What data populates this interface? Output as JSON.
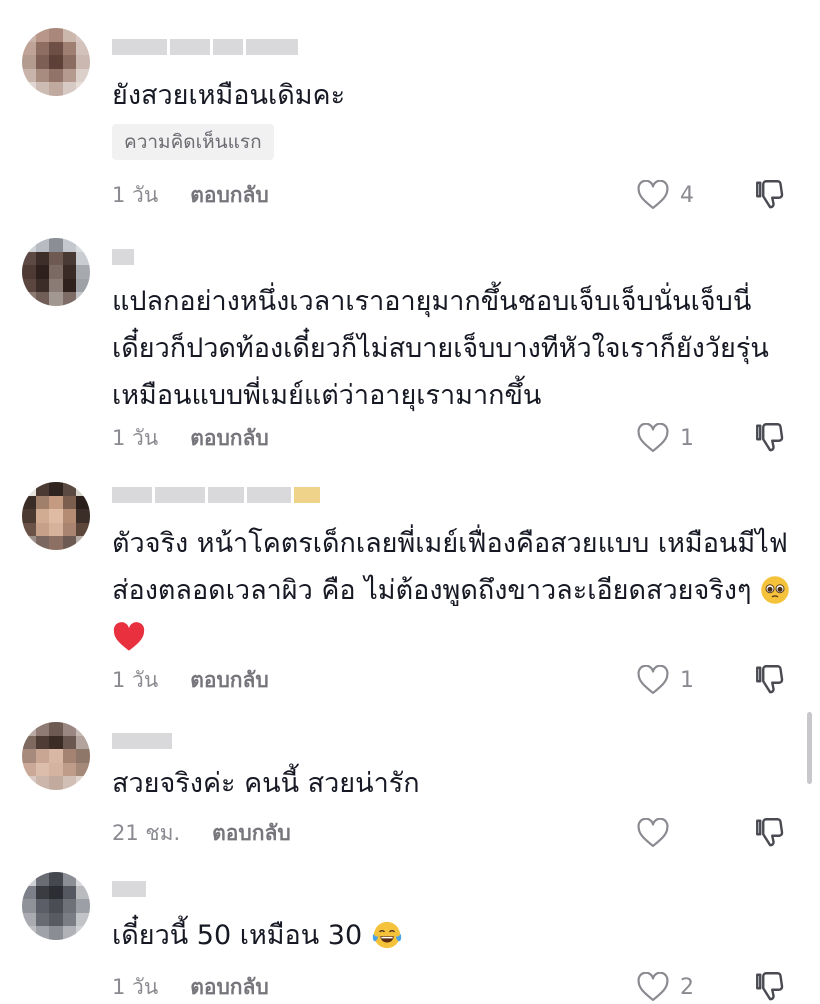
{
  "comments": [
    {
      "text": "ยังสวยเหมือนเดิมคะ",
      "badge": "ความคิดเห็นแรก",
      "time": "1 วัน",
      "reply": "ตอบกลับ",
      "likes": "4",
      "avatar_colors": [
        "#c9b2a8",
        "#b9968a",
        "#a9877b",
        "#ccb7ad",
        "#d8c8c1",
        "#bfa397",
        "#8f6e62",
        "#6d4f46",
        "#9f7f72",
        "#d2c2bb",
        "#b39b90",
        "#7d5f55",
        "#5d4038",
        "#8a6c61",
        "#cbb9b1",
        "#c8b4aa",
        "#a88c80",
        "#927367",
        "#b49a8f",
        "#dcd0ca",
        "#e1d6d1",
        "#cdbcb3",
        "#c0aaa0",
        "#d7c9c3",
        "#e6ddd9"
      ]
    },
    {
      "text": "แปลกอย่างหนึ่งเวลาเราอายุมากขึ้นชอบเจ็บเจ็บนั่นเจ็บนี่เดี๋ยวก็ปวดท้องเดี๋ยวก็ไม่สบายเจ็บบางทีหัวใจเราก็ยังวัยรุ่นเหมือนแบบพี่เมย์แต่ว่าอายุเรามากขึ้น",
      "time": "1 วัน",
      "reply": "ตอบกลับ",
      "likes": "1",
      "avatar_colors": [
        "#cfd3d8",
        "#b8bcc2",
        "#8b8f95",
        "#c4c8ce",
        "#d9dde2",
        "#5d4a44",
        "#3e2e29",
        "#6e5a52",
        "#4a3a35",
        "#c9ccd1",
        "#4d3a33",
        "#2e211d",
        "#7a6a63",
        "#3a2b26",
        "#a6a9ae",
        "#5a463f",
        "#3d2d28",
        "#8a7c75",
        "#2f221e",
        "#9ea1a6",
        "#8d7b73",
        "#6f5d56",
        "#a39791",
        "#7e6d66",
        "#c2c4c8"
      ]
    },
    {
      "text": "ตัวจริง หน้าโคตรเด็กเลยพี่เมย์เฟื่องคือสวยแบบ เหมือนมีไฟส่องตลอดเวลาผิว คือ ไม่ต้องพูดถึงขาวละเอียดสวยจริงๆ",
      "time": "1 วัน",
      "reply": "ตอบกลับ",
      "likes": "1",
      "avatar_colors": [
        "#e6e1dc",
        "#4a3a33",
        "#2f241f",
        "#5b4a42",
        "#d8d2cc",
        "#3a2c26",
        "#a07f6b",
        "#c49a80",
        "#7b5e4e",
        "#2a1f1a",
        "#4b3a31",
        "#d2ab93",
        "#e0bba4",
        "#b48c74",
        "#3b2d27",
        "#6b5246",
        "#c7a089",
        "#d6b29b",
        "#a98470",
        "#5c4639",
        "#9c8e8a",
        "#7a6760",
        "#8d6f63",
        "#6c5a53",
        "#b6aca8"
      ]
    },
    {
      "text": "สวยจริงค่ะ คนนี้ สวยน่ารัก",
      "time": "21 ชม.",
      "reply": "ตอบกลับ",
      "likes": "",
      "avatar_colors": [
        "#b8a9a4",
        "#8f7b74",
        "#6d5a53",
        "#9a8781",
        "#c6b9b4",
        "#7e6961",
        "#4e3c35",
        "#3b2c26",
        "#6a5750",
        "#b3a39d",
        "#a88a7c",
        "#c9a694",
        "#d8b7a5",
        "#a58372",
        "#8e7668",
        "#caa998",
        "#dcbcab",
        "#d4b3a1",
        "#bf9c8a",
        "#a48878",
        "#d9c9c2",
        "#ccb6ab",
        "#c2aa9e",
        "#d1bfb6",
        "#e0d3cd"
      ]
    },
    {
      "text": "เดี๋ยวนี้ 50 เหมือน 30",
      "time": "1 วัน",
      "reply": "ตอบกลับ",
      "likes": "2",
      "avatar_colors": [
        "#cfd0d3",
        "#6a6d74",
        "#45484f",
        "#8b8e94",
        "#d6d7da",
        "#7d8088",
        "#3a3c42",
        "#2c2e33",
        "#555860",
        "#b9bbbf",
        "#8f9299",
        "#5b5e66",
        "#4a4d54",
        "#6e7178",
        "#9c9fa5",
        "#a9abb0",
        "#686b72",
        "#585b62",
        "#7a7d84",
        "#c1c3c7",
        "#bcbec2",
        "#9fa2a8",
        "#8a8d93",
        "#b0b2b7",
        "#d0d1d4"
      ]
    }
  ],
  "icons": {
    "like": "heart-outline-icon",
    "dislike": "thumbs-down-icon",
    "emoji_pleading": "pleading-face-emoji",
    "emoji_heart": "red-heart-emoji",
    "emoji_laugh": "tears-of-joy-emoji"
  },
  "colors": {
    "text": "#161823",
    "meta": "#8a8b91",
    "badge_bg": "#f1f1f2",
    "heart_red": "#e8303f"
  }
}
